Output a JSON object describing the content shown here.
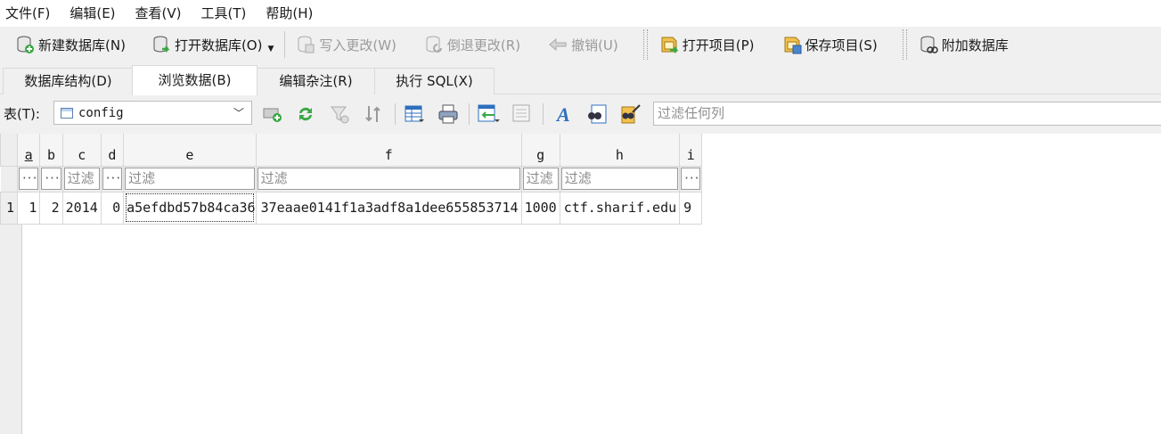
{
  "menu": [
    "文件(F)",
    "编辑(E)",
    "查看(V)",
    "工具(T)",
    "帮助(H)"
  ],
  "toolbar": {
    "new_db": "新建数据库(N)",
    "open_db": "打开数据库(O)",
    "write_changes": "写入更改(W)",
    "revert_changes": "倒退更改(R)",
    "undo": "撤销(U)",
    "open_project": "打开项目(P)",
    "save_project": "保存项目(S)",
    "attach_db": "附加数据库"
  },
  "tabs": [
    {
      "label": "数据库结构(D)",
      "active": false
    },
    {
      "label": "浏览数据(B)",
      "active": true
    },
    {
      "label": "编辑杂注(R)",
      "active": false
    },
    {
      "label": "执行 SQL(X)",
      "active": false
    }
  ],
  "table_selector": {
    "label": "表(T):",
    "value": "config"
  },
  "filter_all_placeholder": "过滤任何列",
  "grid": {
    "filter_placeholder": "过滤",
    "ellipsis": "···",
    "columns": [
      "a",
      "b",
      "c",
      "d",
      "e",
      "f",
      "g",
      "h",
      "i"
    ],
    "rows": [
      {
        "rownum": "1",
        "cells": [
          "1",
          "2",
          "2014",
          "0",
          "a5efdbd57b84ca36",
          "37eaae0141f1a3adf8a1dee655853714",
          "1000",
          "ctf.sharif.edu",
          "9"
        ]
      }
    ]
  },
  "colors": {
    "accent": "#2e7bcf",
    "toolbar_bg": "#f0f0f0",
    "grid_border": "#d7d7d7"
  }
}
